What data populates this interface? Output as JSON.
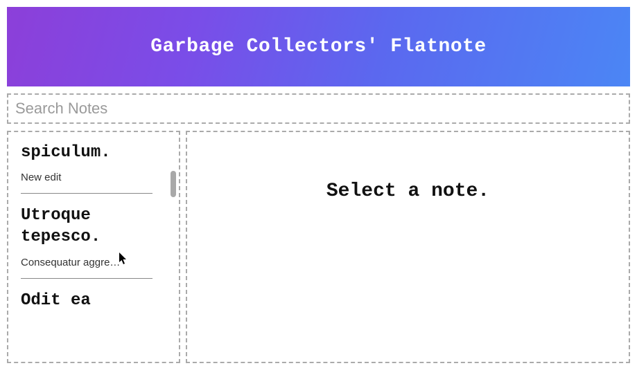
{
  "header": {
    "title": "Garbage Collectors' Flatnote"
  },
  "search": {
    "placeholder": "Search Notes"
  },
  "sidebar": {
    "notes": [
      {
        "title": "spiculum.",
        "preview": "New edit"
      },
      {
        "title": "Utroque tepesco.",
        "preview": "Consequatur aggre…"
      },
      {
        "title": "Odit ea",
        "preview": ""
      }
    ]
  },
  "main": {
    "empty_text": "Select a note."
  }
}
